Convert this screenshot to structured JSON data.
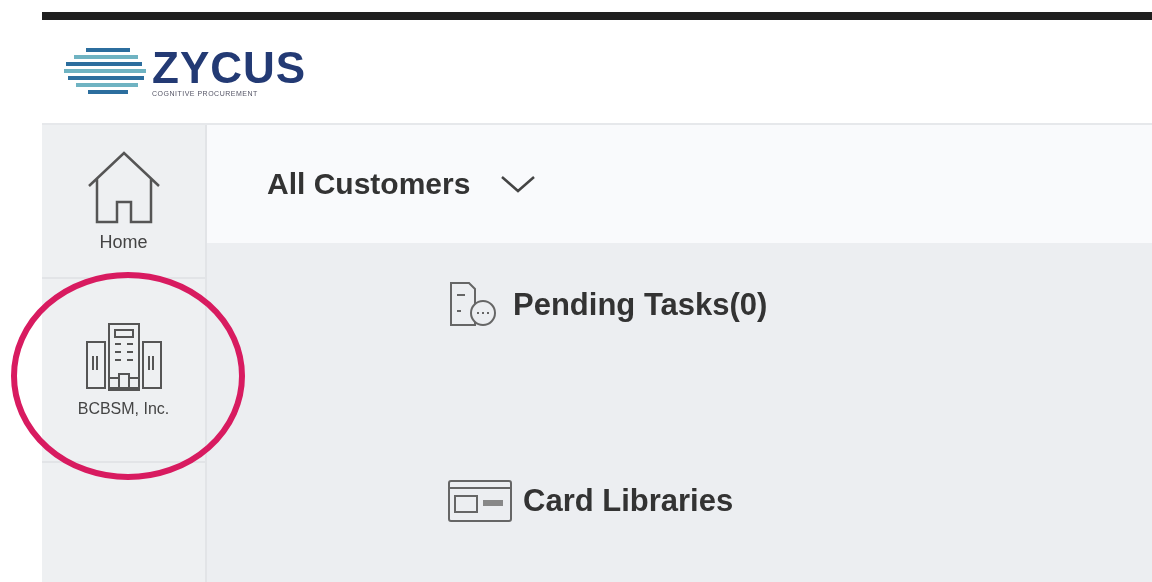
{
  "logo": {
    "name": "ZYCUS",
    "tagline": "COGNITIVE PROCUREMENT"
  },
  "sidebar": {
    "items": [
      {
        "label": "Home",
        "kind": "home",
        "circled": false
      },
      {
        "label": "BCBSM, Inc.",
        "kind": "company",
        "circled": true
      }
    ]
  },
  "customer_selector": {
    "label": "All Customers"
  },
  "sections": [
    {
      "title": "Pending Tasks(0)",
      "kind": "tasks"
    },
    {
      "title": "Card Libraries",
      "kind": "cards"
    }
  ]
}
